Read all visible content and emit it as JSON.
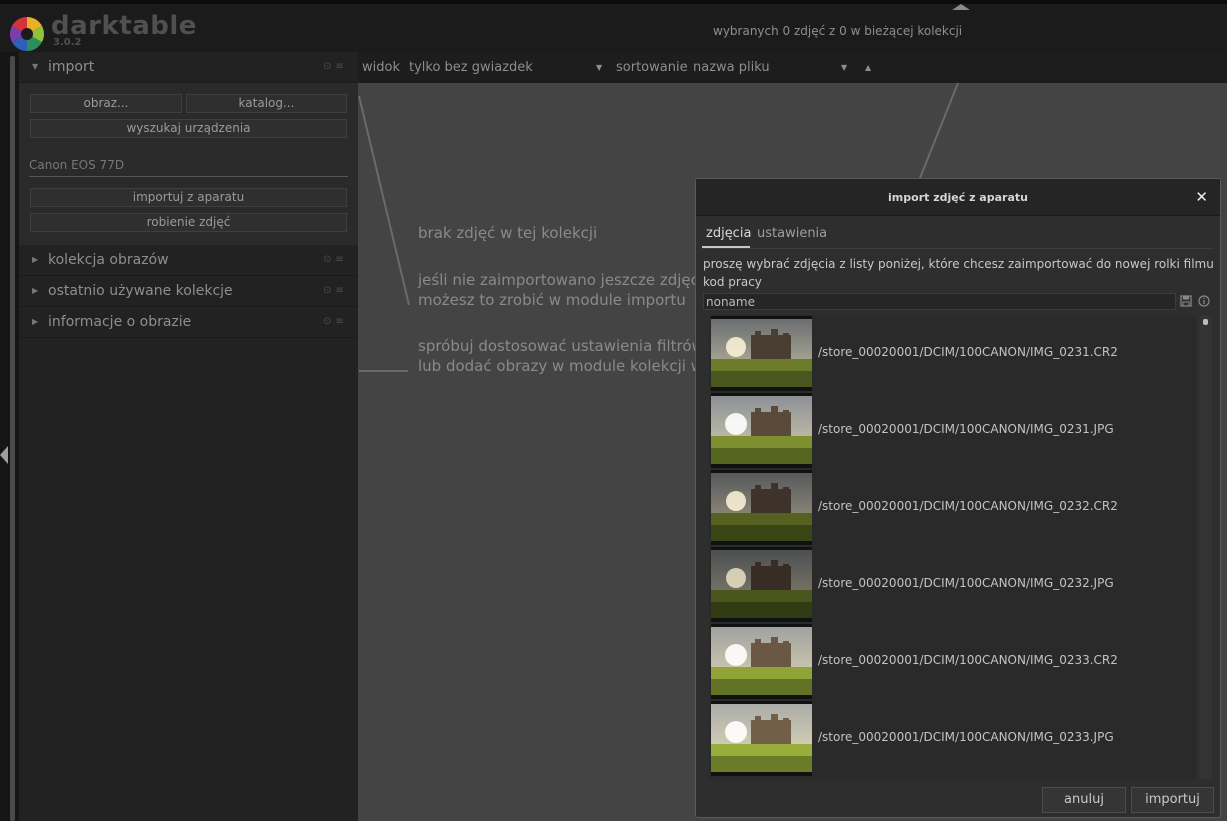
{
  "header": {
    "app_name": "darktable",
    "version": "3.0.2",
    "selection_info": "wybranych 0 zdjęć z 0 w bieżącej kolekcji"
  },
  "left_panel": {
    "import": {
      "title": "import",
      "image_button": "obraz...",
      "folder_button": "katalog...",
      "scan_button": "wyszukaj urządzenia",
      "device_name": "Canon EOS 77D",
      "import_camera_button": "importuj z aparatu",
      "tethered_button": "robienie zdjęć"
    },
    "modules": [
      {
        "title": "kolekcja obrazów"
      },
      {
        "title": "ostatnio używane kolekcje"
      },
      {
        "title": "informacje o obrazie"
      }
    ]
  },
  "filterbar": {
    "view_label": "widok",
    "view_value": "tylko bez gwiazdek",
    "sort_label": "sortowanie",
    "sort_value": "nazwa pliku"
  },
  "lighttable": {
    "msg_empty": "brak zdjęć w tej kolekcji",
    "msg_import_1": "jeśli nie zaimportowano jeszcze zdjęć,",
    "msg_import_2": "możesz to zrobić w module importu",
    "msg_filter_1": "spróbuj dostosować ustawienia filtrów",
    "msg_filter_2": "lub dodać obrazy w module kolekcji w"
  },
  "dialog": {
    "title": "import zdjęć z aparatu",
    "tabs": [
      "zdjęcia",
      "ustawienia"
    ],
    "instruction": "proszę wybrać zdjęcia z listy poniżej, które chcesz zaimportować do nowej rolki filmu",
    "jobcode_label": "kod pracy",
    "jobcode_value": "noname",
    "files": [
      "/store_00020001/DCIM/100CANON/IMG_0231.CR2",
      "/store_00020001/DCIM/100CANON/IMG_0231.JPG",
      "/store_00020001/DCIM/100CANON/IMG_0232.CR2",
      "/store_00020001/DCIM/100CANON/IMG_0232.JPG",
      "/store_00020001/DCIM/100CANON/IMG_0233.CR2",
      "/store_00020001/DCIM/100CANON/IMG_0233.JPG"
    ],
    "cancel_button": "anuluj",
    "import_button": "importuj"
  },
  "icons": {
    "logo": "darktable-aperture-icon",
    "close": "close-icon",
    "save": "save-icon",
    "info": "info-icon"
  }
}
